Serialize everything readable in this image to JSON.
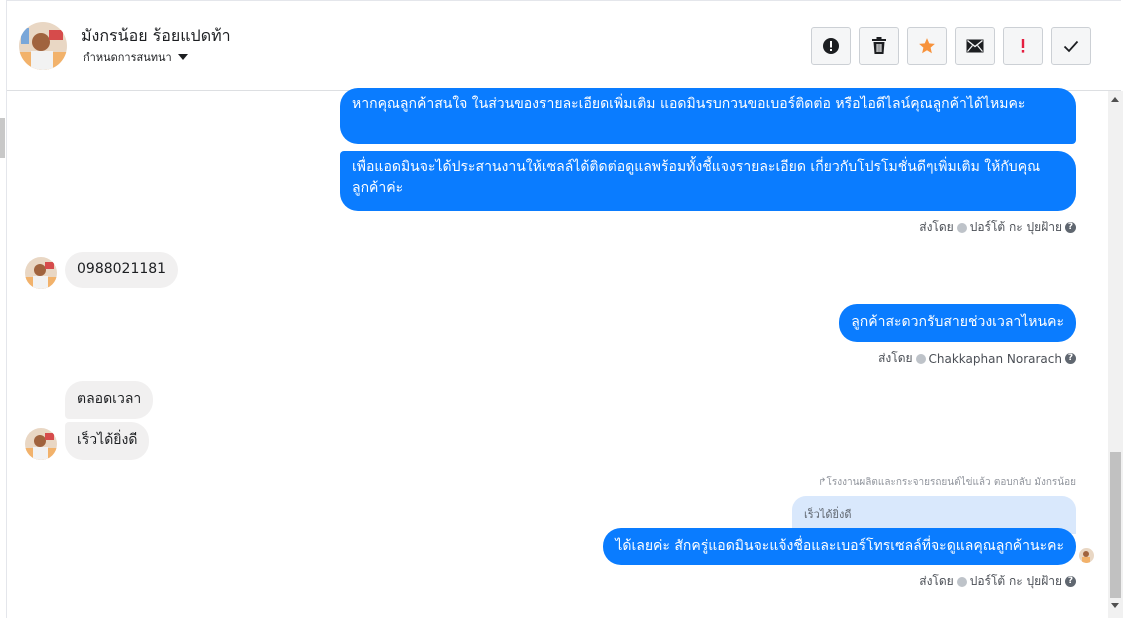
{
  "header": {
    "contact_name": "มังกรน้อย ร้อยแปดท้า",
    "assign_label": "กำหนดการสนทนา",
    "actions": [
      {
        "icon": "alert-circle-icon",
        "name": "mark-spam-button"
      },
      {
        "icon": "trash-icon",
        "name": "delete-button"
      },
      {
        "icon": "star-icon",
        "name": "star-button"
      },
      {
        "icon": "envelope-icon",
        "name": "mark-unread-button"
      },
      {
        "icon": "exclamation-icon",
        "name": "follow-up-button"
      },
      {
        "icon": "checkmark-icon",
        "name": "mark-done-button"
      }
    ]
  },
  "messages": {
    "m1": "หากคุณลูกค้าสนใจ ในส่วนของรายละเอียดเพิ่มเติม แอดมินรบกวนขอเบอร์ติดต่อ หรือไอดีไลน์คุณลูกค้าได้ไหมคะ",
    "m2": "เพื่อแอดมินจะได้ประสานงานให้เซลล์ได้ติดต่อดูแลพร้อมทั้งชี้แจงรายละเอียด เกี่ยวกับโปรโมชั่นดีๆเพิ่มเติม ให้กับคุณลูกค้าค่ะ",
    "sent_by_1": {
      "prefix": "ส่งโดย",
      "agent": "ปอร์โต้ กะ ปุยฝ้าย"
    },
    "m3": "0988021181",
    "m4": "ลูกค้าสะดวกรับสายช่วงเวลาไหนคะ",
    "sent_by_2": {
      "prefix": "ส่งโดย",
      "agent": "Chakkaphan Norarach"
    },
    "m5": "ตลอดเวลา",
    "m6": "เร็วได้ยิ่งดี",
    "reply_note": "โรงงานผลิตและกระจายรถยนต์ไข่แล้ว ตอบกลับ มังกรน้อย",
    "quoted": "เร็วได้ยิ่งดี",
    "m7": "ได้เลยค่ะ สักครู่แอดมินจะแจ้งชื่อและเบอร์โทรเซลล์ที่จะดูแลคุณลูกค้านะคะ",
    "sent_by_3": {
      "prefix": "ส่งโดย",
      "agent": "ปอร์โต้ กะ ปุยฝ้าย"
    }
  },
  "colors": {
    "outgoing_bubble": "#0a7cff",
    "incoming_bubble": "#f1f0f0",
    "quoted_bubble": "#d9e8fc",
    "star": "#f7923b",
    "alert_red": "#e41e3f"
  }
}
